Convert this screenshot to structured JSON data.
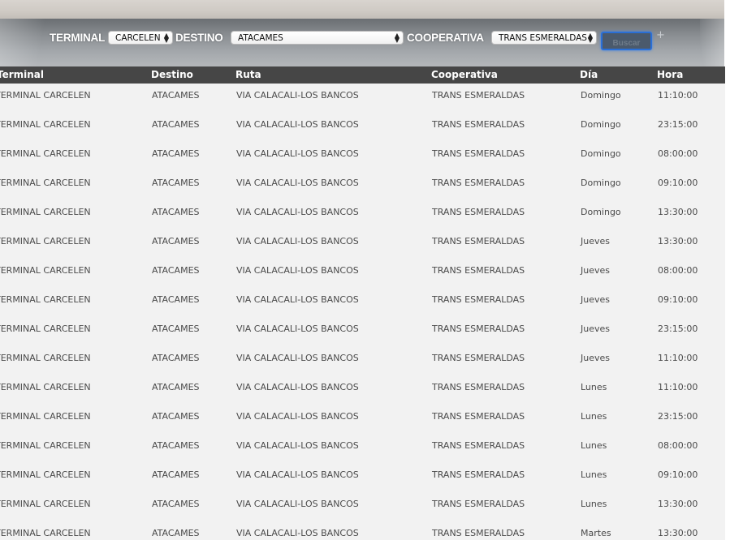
{
  "filters": {
    "terminal_label": "TERMINAL",
    "terminal_value": "CARCELEN",
    "destino_label": "DESTINO",
    "destino_value": "ATACAMES",
    "cooperativa_label": "COOPERATIVA",
    "cooperativa_value": "TRANS ESMERALDAS",
    "search_label": "Buscar",
    "extra_symbol": "+"
  },
  "table": {
    "headers": [
      "Terminal",
      "Destino",
      "Ruta",
      "Cooperativa",
      "Día",
      "Hora"
    ],
    "rows": [
      [
        "TERMINAL CARCELEN",
        "ATACAMES",
        "VIA CALACALI-LOS BANCOS",
        "TRANS ESMERALDAS",
        "Domingo",
        "11:10:00"
      ],
      [
        "TERMINAL CARCELEN",
        "ATACAMES",
        "VIA CALACALI-LOS BANCOS",
        "TRANS ESMERALDAS",
        "Domingo",
        "23:15:00"
      ],
      [
        "TERMINAL CARCELEN",
        "ATACAMES",
        "VIA CALACALI-LOS BANCOS",
        "TRANS ESMERALDAS",
        "Domingo",
        "08:00:00"
      ],
      [
        "TERMINAL CARCELEN",
        "ATACAMES",
        "VIA CALACALI-LOS BANCOS",
        "TRANS ESMERALDAS",
        "Domingo",
        "09:10:00"
      ],
      [
        "TERMINAL CARCELEN",
        "ATACAMES",
        "VIA CALACALI-LOS BANCOS",
        "TRANS ESMERALDAS",
        "Domingo",
        "13:30:00"
      ],
      [
        "TERMINAL CARCELEN",
        "ATACAMES",
        "VIA CALACALI-LOS BANCOS",
        "TRANS ESMERALDAS",
        "Jueves",
        "13:30:00"
      ],
      [
        "TERMINAL CARCELEN",
        "ATACAMES",
        "VIA CALACALI-LOS BANCOS",
        "TRANS ESMERALDAS",
        "Jueves",
        "08:00:00"
      ],
      [
        "TERMINAL CARCELEN",
        "ATACAMES",
        "VIA CALACALI-LOS BANCOS",
        "TRANS ESMERALDAS",
        "Jueves",
        "09:10:00"
      ],
      [
        "TERMINAL CARCELEN",
        "ATACAMES",
        "VIA CALACALI-LOS BANCOS",
        "TRANS ESMERALDAS",
        "Jueves",
        "23:15:00"
      ],
      [
        "TERMINAL CARCELEN",
        "ATACAMES",
        "VIA CALACALI-LOS BANCOS",
        "TRANS ESMERALDAS",
        "Jueves",
        "11:10:00"
      ],
      [
        "TERMINAL CARCELEN",
        "ATACAMES",
        "VIA CALACALI-LOS BANCOS",
        "TRANS ESMERALDAS",
        "Lunes",
        "11:10:00"
      ],
      [
        "TERMINAL CARCELEN",
        "ATACAMES",
        "VIA CALACALI-LOS BANCOS",
        "TRANS ESMERALDAS",
        "Lunes",
        "23:15:00"
      ],
      [
        "TERMINAL CARCELEN",
        "ATACAMES",
        "VIA CALACALI-LOS BANCOS",
        "TRANS ESMERALDAS",
        "Lunes",
        "08:00:00"
      ],
      [
        "TERMINAL CARCELEN",
        "ATACAMES",
        "VIA CALACALI-LOS BANCOS",
        "TRANS ESMERALDAS",
        "Lunes",
        "09:10:00"
      ],
      [
        "TERMINAL CARCELEN",
        "ATACAMES",
        "VIA CALACALI-LOS BANCOS",
        "TRANS ESMERALDAS",
        "Lunes",
        "13:30:00"
      ],
      [
        "TERMINAL CARCELEN",
        "ATACAMES",
        "VIA CALACALI-LOS BANCOS",
        "TRANS ESMERALDAS",
        "Martes",
        "13:30:00"
      ]
    ]
  }
}
